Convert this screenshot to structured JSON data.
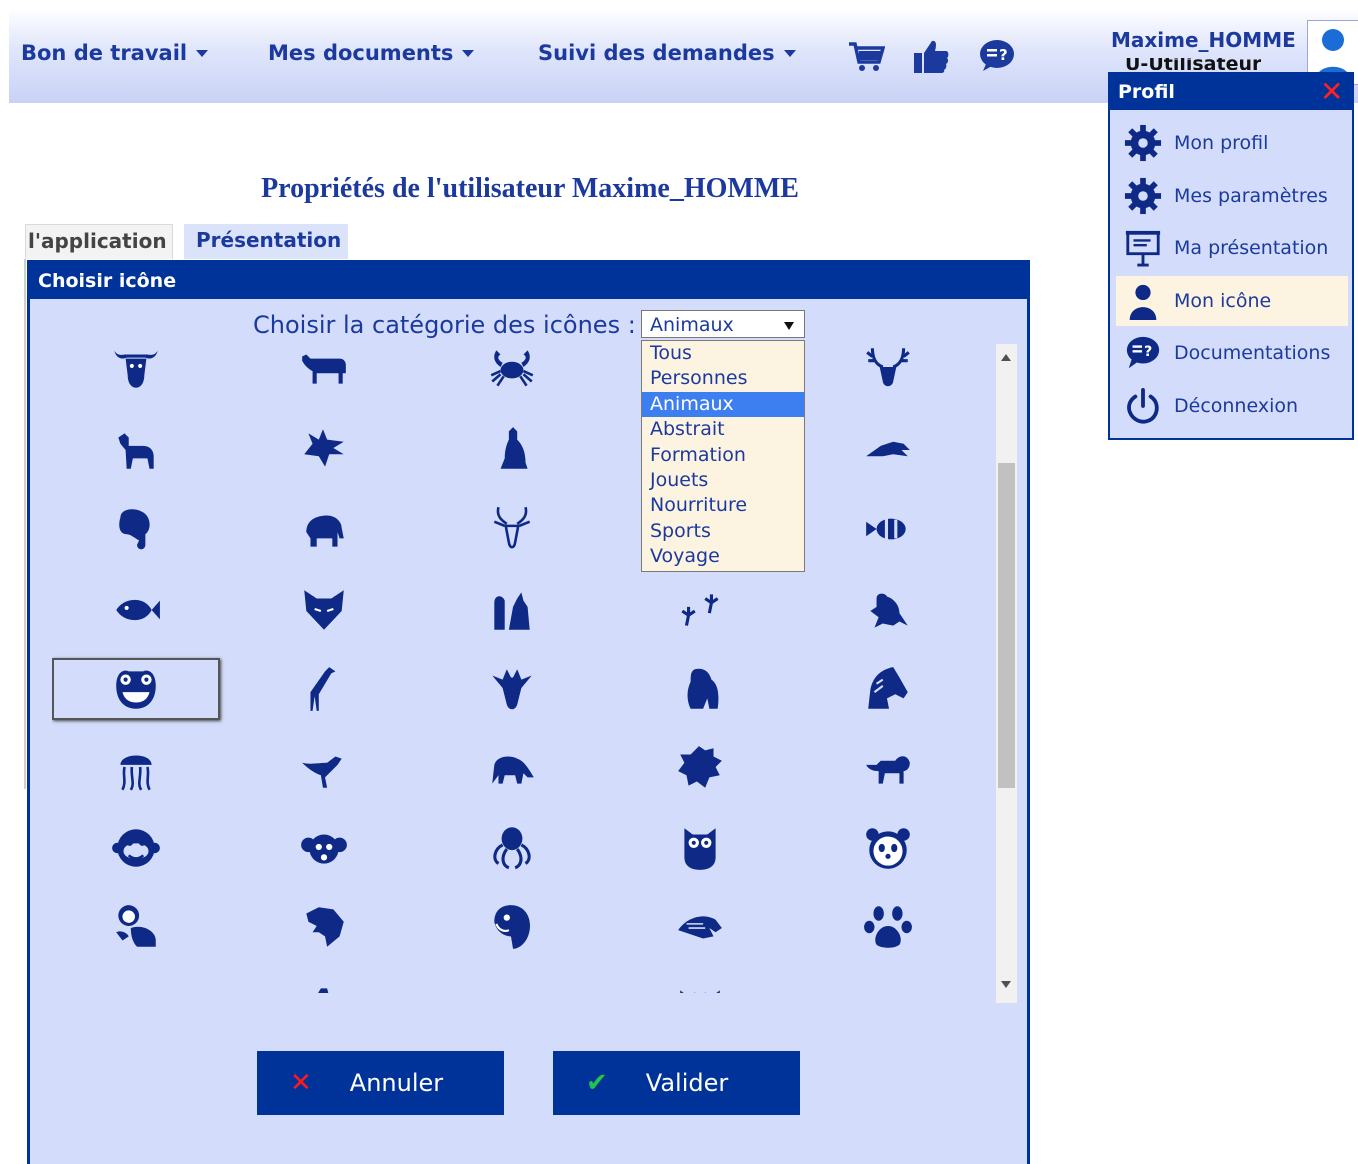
{
  "nav": {
    "items": [
      {
        "label": "Bon de travail"
      },
      {
        "label": "Mes documents"
      },
      {
        "label": "Suivi des demandes"
      }
    ],
    "icons": [
      "cart-icon",
      "thumbs-up-icon",
      "help-chat-icon"
    ],
    "user_name": "Maxime_HOMME",
    "user_role": "U-Utilisateur"
  },
  "page": {
    "title": "Propriétés de l'utilisateur Maxime_HOMME",
    "tabs": [
      {
        "label": "l'application",
        "active": false
      },
      {
        "label": "Présentation",
        "active": true
      }
    ]
  },
  "modal": {
    "title": "Choisir icône",
    "category_label": "Choisir la catégorie des icônes :",
    "category_value": "Animaux",
    "category_options": [
      "Tous",
      "Personnes",
      "Animaux",
      "Abstrait",
      "Formation",
      "Jouets",
      "Nourriture",
      "Sports",
      "Voyage"
    ],
    "selected_option": "Animaux",
    "icons": [
      [
        "bull-icon",
        "cow-icon",
        "crab-icon",
        "hidden",
        "deer-icon"
      ],
      [
        "dog-icon",
        "dragon-icon",
        "sitting-dog-icon",
        "hidden",
        "eagle-icon"
      ],
      [
        "elephant-head-icon",
        "elephant-icon",
        "antelope-icon",
        "hidden",
        "clownfish-icon"
      ],
      [
        "fish-icon",
        "fox-icon",
        "squirrel-icon",
        "footprints-icon",
        "frog-icon"
      ],
      [
        "frog-face-icon",
        "giraffe-icon",
        "giraffe-head-icon",
        "gorilla-icon",
        "horse-head-icon"
      ],
      [
        "jellyfish-icon",
        "kangaroo-icon",
        "anteater-icon",
        "lion-head-icon",
        "lion-icon"
      ],
      [
        "monkey-icon",
        "mouse-icon",
        "octopus-icon",
        "owl-icon",
        "panda-face-icon"
      ],
      [
        "panda-icon",
        "panther-icon",
        "parrot-icon",
        "eagle-wing-icon",
        "paw-icon"
      ],
      [
        "platypus-icon",
        "penguin-icon",
        "seal-icon",
        "bat-icon",
        "bird-icon"
      ]
    ],
    "selected_icon": "frog-face-icon",
    "cancel_label": "Annuler",
    "ok_label": "Valider"
  },
  "profile_menu": {
    "title": "Profil",
    "items": [
      {
        "label": "Mon profil",
        "icon": "gear-icon"
      },
      {
        "label": "Mes paramètres",
        "icon": "gear-icon"
      },
      {
        "label": "Ma présentation",
        "icon": "presentation-icon"
      },
      {
        "label": "Mon icône",
        "icon": "user-icon",
        "active": true
      },
      {
        "label": "Documentations",
        "icon": "help-chat-icon"
      },
      {
        "label": "Déconnexion",
        "icon": "power-icon"
      }
    ]
  },
  "colors": {
    "primary": "#003399",
    "panel": "#d3ddfb",
    "text": "#1c3a9e",
    "highlight": "#fdf3e1"
  }
}
